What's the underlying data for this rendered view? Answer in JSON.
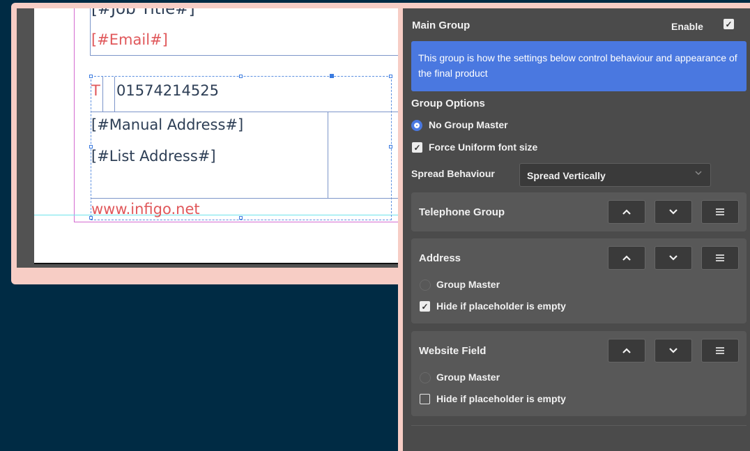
{
  "document": {
    "job_title": "[#Job Title#]",
    "email": "[#Email#]",
    "phone_prefix": "T",
    "phone": "01574214525",
    "manual_address": "[#Manual Address#]",
    "list_address": "[#List Address#]",
    "website": "www.infigo.net"
  },
  "panel": {
    "title": "Main Group",
    "enable_label": "Enable",
    "enable_checked": true,
    "info": "This group is how the settings below control behaviour and appearance of the final product",
    "group_options_title": "Group Options",
    "no_group_master_label": "No Group Master",
    "force_uniform_label": "Force Uniform font size",
    "spread_label": "Spread Behaviour",
    "spread_value": "Spread Vertically",
    "groups": [
      {
        "name": "Telephone Group"
      },
      {
        "name": "Address",
        "group_master_label": "Group Master",
        "hide_label": "Hide if placeholder is empty",
        "hide_checked": true
      },
      {
        "name": "Website Field",
        "group_master_label": "Group Master",
        "hide_label": "Hide if placeholder is empty",
        "hide_checked": false
      }
    ]
  },
  "icons": {
    "check": "✓",
    "chevron_up": "chevron-up-icon",
    "chevron_down": "chevron-down-icon",
    "menu": "menu-icon"
  },
  "colors": {
    "accent": "#4a78e0",
    "panel_bg": "#4b4b4b",
    "background": "#002b44",
    "frame": "#f7cdc5",
    "doc_text": "#2d3e55",
    "doc_red": "#e0585b"
  }
}
